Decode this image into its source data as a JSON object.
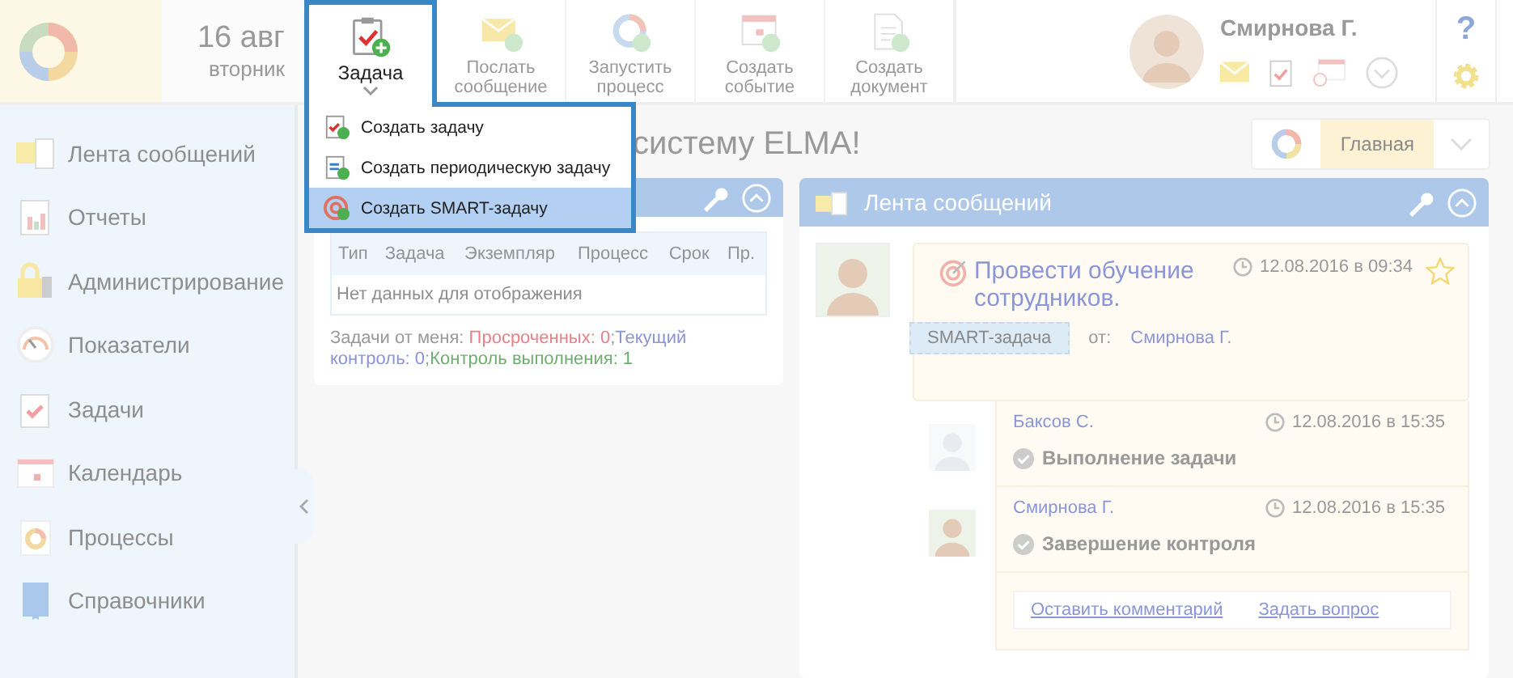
{
  "header": {
    "date": "16 авг",
    "weekday": "вторник"
  },
  "toolbar": [
    {
      "label": "Задача",
      "kind": "task",
      "active": true
    },
    {
      "label": "Послать сообщение",
      "kind": "message",
      "active": false
    },
    {
      "label": "Запустить процесс",
      "kind": "process",
      "active": false
    },
    {
      "label": "Создать событие",
      "kind": "event",
      "active": false
    },
    {
      "label": "Создать документ",
      "kind": "document",
      "active": false
    }
  ],
  "user": {
    "name": "Смирнова Г."
  },
  "help": "?",
  "dropdown": [
    {
      "label": "Создать задачу",
      "kind": "task",
      "selected": false
    },
    {
      "label": "Создать периодическую задачу",
      "kind": "periodic",
      "selected": false
    },
    {
      "label": "Создать SMART-задачу",
      "kind": "smart",
      "selected": true
    }
  ],
  "sidebar": [
    {
      "label": "Лента сообщений",
      "kind": "feed"
    },
    {
      "label": "Отчеты",
      "kind": "reports"
    },
    {
      "label": "Администрирование",
      "kind": "admin"
    },
    {
      "label": "Показатели",
      "kind": "gauge"
    },
    {
      "label": "Задачи",
      "kind": "tasks"
    },
    {
      "label": "Календарь",
      "kind": "calendar"
    },
    {
      "label": "Процессы",
      "kind": "processes"
    },
    {
      "label": "Справочники",
      "kind": "book"
    }
  ],
  "page_title": "систему ELMA!",
  "home_switcher": {
    "label": "Главная",
    "selected": true
  },
  "tasks_widget": {
    "columns": [
      "Тип",
      "Задача",
      "Экземпляр",
      "Процесс",
      "Срок",
      "Пр."
    ],
    "empty": "Нет данных для отображения",
    "summary_label": "Задачи от меня:",
    "separator": ";",
    "counters": [
      {
        "text": "Просроченных: 0",
        "color": "#e8808a"
      },
      {
        "text": "Текущий контроль: 0",
        "color": "#8a94d8"
      },
      {
        "text": "Контроль выполнения: 1",
        "color": "#6fae6f"
      }
    ]
  },
  "feed": {
    "title": "Лента сообщений",
    "post": {
      "title": "Провести обучение сотрудников.",
      "time": "12.08.2016 в 09:34",
      "starred": false,
      "tag": "SMART-задача",
      "from_label": "от:",
      "author": "Смирнова Г.",
      "events": [
        {
          "author": "Баксов С.",
          "time": "12.08.2016 в 15:35",
          "action": "Выполнение задачи",
          "kind": "placeholder"
        },
        {
          "author": "Смирнова Г.",
          "time": "12.08.2016 в 15:35",
          "action": "Завершение контроля",
          "kind": "photo"
        }
      ],
      "actions": [
        "Оставить комментарий",
        "Задать вопрос"
      ]
    }
  }
}
